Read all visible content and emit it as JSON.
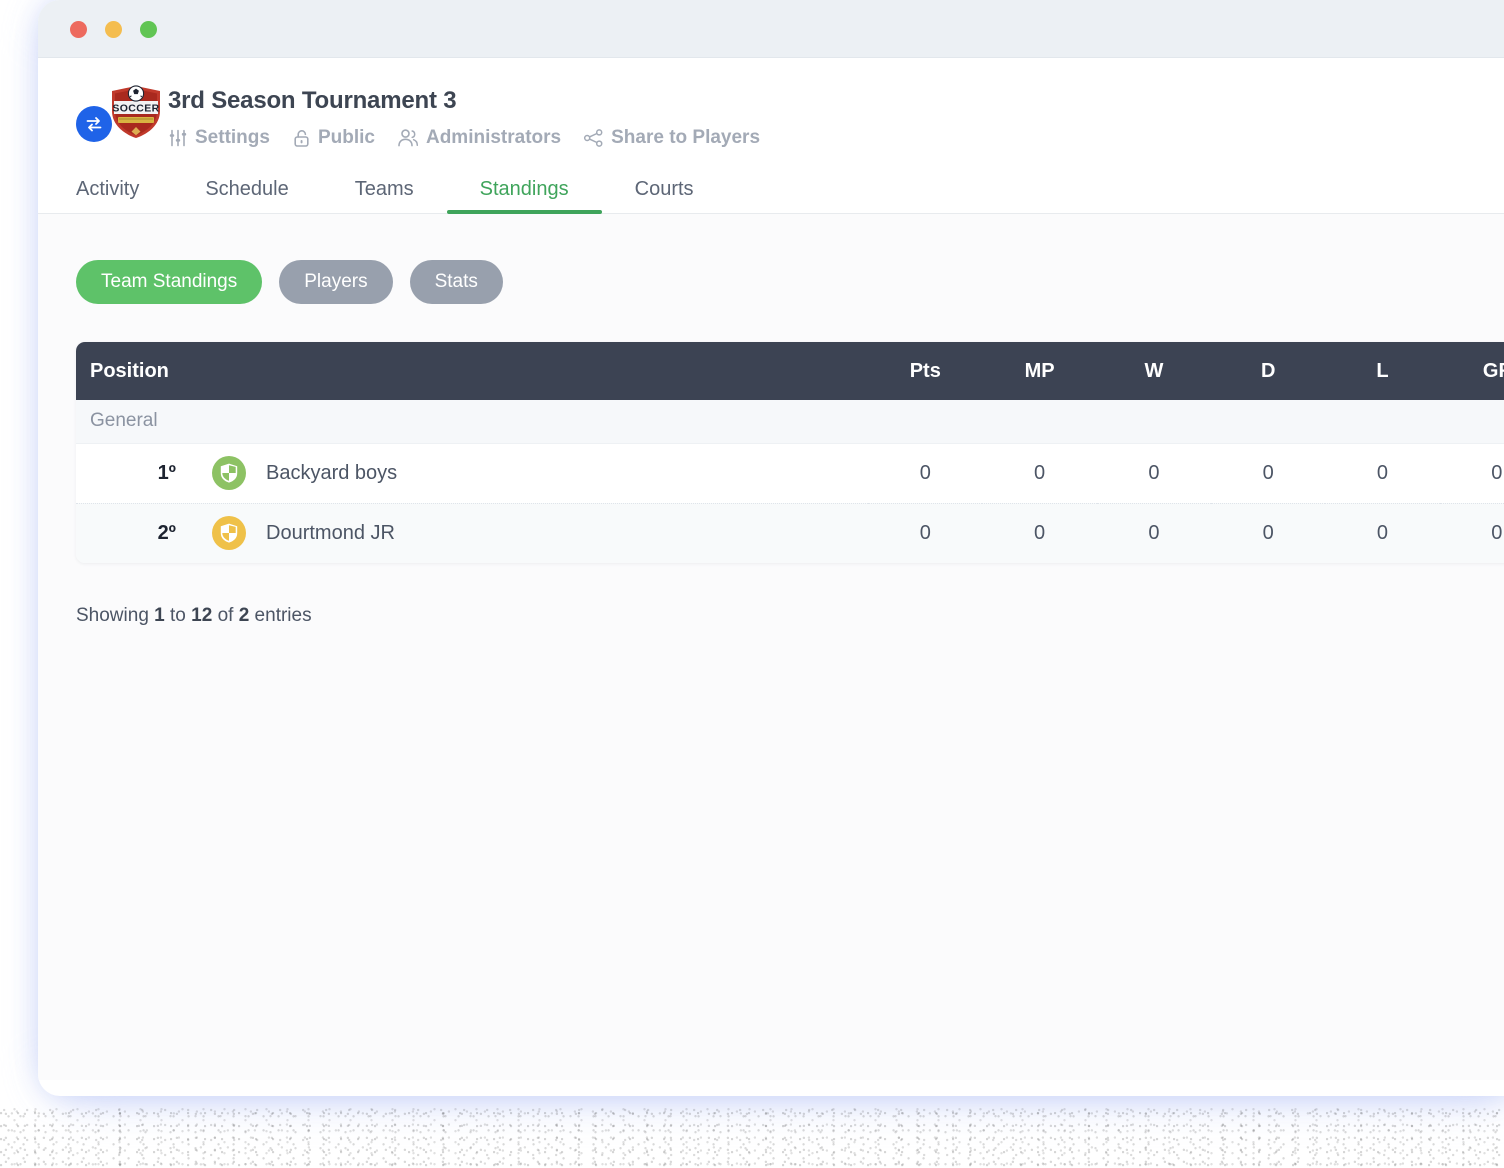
{
  "window": {
    "traffic_lights": [
      {
        "name": "close",
        "color": "#ed6a5e"
      },
      {
        "name": "minimize",
        "color": "#f4bd4f"
      },
      {
        "name": "maximize",
        "color": "#61c554"
      }
    ]
  },
  "header": {
    "logo_alt": "soccer-shield-badge",
    "swap_button_icon": "swap-arrows-icon",
    "title": "3rd Season Tournament 3",
    "meta": [
      {
        "icon": "sliders-icon",
        "label": "Settings"
      },
      {
        "icon": "unlock-icon",
        "label": "Public"
      },
      {
        "icon": "users-icon",
        "label": "Administrators"
      },
      {
        "icon": "share-nodes-icon",
        "label": "Share to Players"
      }
    ]
  },
  "tabs": [
    {
      "label": "Activity",
      "active": false
    },
    {
      "label": "Schedule",
      "active": false
    },
    {
      "label": "Teams",
      "active": false
    },
    {
      "label": "Standings",
      "active": true
    },
    {
      "label": "Courts",
      "active": false
    }
  ],
  "pills": [
    {
      "label": "Team Standings",
      "active": true
    },
    {
      "label": "Players",
      "active": false
    },
    {
      "label": "Stats",
      "active": false
    }
  ],
  "table": {
    "columns": [
      "Position",
      "Pts",
      "MP",
      "W",
      "D",
      "L",
      "GF"
    ],
    "group_label": "General",
    "rows": [
      {
        "rank": "1º",
        "team": "Backyard boys",
        "badge_color": "#8dc264",
        "badge_icon": "shield-icon",
        "pts": "0",
        "mp": "0",
        "w": "0",
        "d": "0",
        "l": "0",
        "gf": "0"
      },
      {
        "rank": "2º",
        "team": "Dourtmond JR",
        "badge_color": "#efc149",
        "badge_icon": "shield-icon",
        "pts": "0",
        "mp": "0",
        "w": "0",
        "d": "0",
        "l": "0",
        "gf": "0"
      }
    ]
  },
  "footer": {
    "prefix": "Showing ",
    "from": "1",
    "mid": " to ",
    "to": "12",
    "mid2": " of ",
    "total": "2",
    "suffix": " entries"
  },
  "colors": {
    "accent_green": "#3fa45b",
    "pill_green": "#5ec269",
    "table_header": "#3c4353",
    "titlebar": "#ecf0f4",
    "swap_blue": "#1f63e8"
  }
}
